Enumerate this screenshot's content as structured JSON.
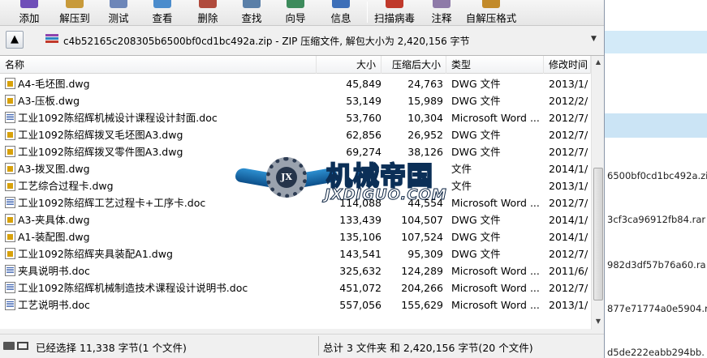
{
  "toolbar": {
    "buttons": [
      {
        "label": "添加",
        "icon": "add-icon"
      },
      {
        "label": "解压到",
        "icon": "extract-to-icon"
      },
      {
        "label": "测试",
        "icon": "test-icon"
      },
      {
        "label": "查看",
        "icon": "view-icon"
      },
      {
        "label": "删除",
        "icon": "delete-icon"
      },
      {
        "label": "查找",
        "icon": "find-icon"
      },
      {
        "label": "向导",
        "icon": "wizard-icon"
      },
      {
        "label": "信息",
        "icon": "info-icon"
      },
      {
        "label": "扫描病毒",
        "icon": "virus-scan-icon"
      },
      {
        "label": "注释",
        "icon": "comment-icon"
      },
      {
        "label": "自解压格式",
        "icon": "sfx-icon"
      }
    ]
  },
  "address": {
    "text": "c4b52165c208305b6500bf0cd1bc492a.zip - ZIP 压缩文件, 解包大小为 2,420,156 字节"
  },
  "columns": {
    "name": "名称",
    "size": "大小",
    "packed": "压缩后大小",
    "type": "类型",
    "modified": "修改时间"
  },
  "files": [
    {
      "name": "A4-毛坯图.dwg",
      "kind": "dwg",
      "size": "45,849",
      "packed": "24,763",
      "type": "DWG 文件",
      "modified": "2013/1/"
    },
    {
      "name": "A3-压板.dwg",
      "kind": "dwg",
      "size": "53,149",
      "packed": "15,989",
      "type": "DWG 文件",
      "modified": "2012/2/"
    },
    {
      "name": "工业1092陈绍辉机械设计课程设计封面.doc",
      "kind": "doc",
      "size": "53,760",
      "packed": "10,304",
      "type": "Microsoft Word ...",
      "modified": "2012/7/"
    },
    {
      "name": "工业1092陈绍辉拨叉毛坯图A3.dwg",
      "kind": "dwg",
      "size": "62,856",
      "packed": "26,952",
      "type": "DWG 文件",
      "modified": "2012/7/"
    },
    {
      "name": "工业1092陈绍辉拨叉零件图A3.dwg",
      "kind": "dwg",
      "size": "69,274",
      "packed": "38,126",
      "type": "DWG 文件",
      "modified": "2012/7/"
    },
    {
      "name": "A3-拨叉图.dwg",
      "kind": "dwg",
      "size": "",
      "packed": "",
      "type": "文件",
      "modified": "2014/1/"
    },
    {
      "name": "工艺综合过程卡.dwg",
      "kind": "dwg",
      "size": "",
      "packed": "",
      "type": "文件",
      "modified": "2013/1/"
    },
    {
      "name": "工业1092陈绍辉工艺过程卡+工序卡.doc",
      "kind": "doc",
      "size": "114,088",
      "packed": "44,554",
      "type": "Microsoft Word ...",
      "modified": "2012/7/"
    },
    {
      "name": "A3-夹具体.dwg",
      "kind": "dwg",
      "size": "133,439",
      "packed": "104,507",
      "type": "DWG 文件",
      "modified": "2014/1/"
    },
    {
      "name": "A1-装配图.dwg",
      "kind": "dwg",
      "size": "135,106",
      "packed": "107,524",
      "type": "DWG 文件",
      "modified": "2014/1/"
    },
    {
      "name": "工业1092陈绍辉夹具装配A1.dwg",
      "kind": "dwg",
      "size": "143,541",
      "packed": "95,309",
      "type": "DWG 文件",
      "modified": "2012/7/"
    },
    {
      "name": "夹具说明书.doc",
      "kind": "doc",
      "size": "325,632",
      "packed": "124,289",
      "type": "Microsoft Word ...",
      "modified": "2011/6/"
    },
    {
      "name": "工业1092陈绍辉机械制造技术课程设计说明书.doc",
      "kind": "doc",
      "size": "451,072",
      "packed": "204,266",
      "type": "Microsoft Word ...",
      "modified": "2012/7/"
    },
    {
      "name": "工艺说明书.doc",
      "kind": "doc",
      "size": "557,056",
      "packed": "155,629",
      "type": "Microsoft Word ...",
      "modified": "2013/1/"
    }
  ],
  "status": {
    "selected": "已经选择 11,338 字节(1 个文件)",
    "total": "总计 3 文件夹 和 2,420,156 字节(20 个文件)"
  },
  "background_window": {
    "rows": [
      "6500bf0cd1bc492a.zi",
      "3cf3ca96912fb84.rar",
      "982d3df57b76a60.ra",
      "877e71774a0e5904.ra",
      "d5de222eabb294bb."
    ]
  },
  "watermark": {
    "cn": "机械帝国",
    "en": "JXDIGUO.COM",
    "badge": "JX"
  },
  "colors": {
    "accent_blue": "#1976c8",
    "bg_band": "#cfe6f6",
    "dwg_icon": "#d8a10a"
  }
}
